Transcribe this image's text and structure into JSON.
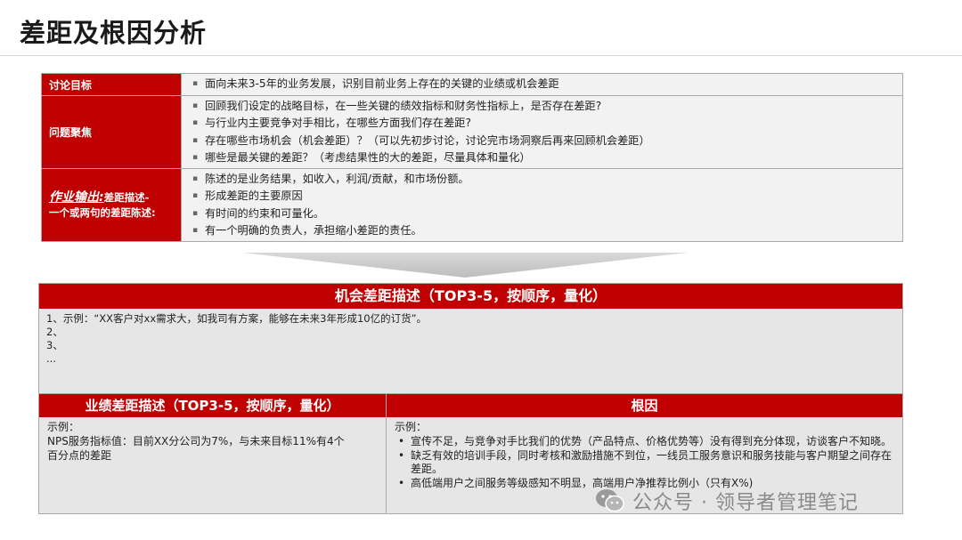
{
  "page": {
    "title": "差距及根因分析"
  },
  "top": {
    "rows": [
      {
        "label": "讨论目标",
        "items": [
          "面向未来3-5年的业务发展，识别目前业务上存在的关键的业绩或机会差距"
        ]
      },
      {
        "label": "问题聚焦",
        "items": [
          "回顾我们设定的战略目标，在一些关键的绩效指标和财务性指标上，是否存在差距?",
          "与行业内主要竞争对手相比，在哪些方面我们存在差距?",
          "存在哪些市场机会（机会差距）？（可以先初步讨论，讨论完市场洞察后再来回顾机会差距）",
          "哪些是最关键的差距？（考虑结果性的大的差距，尽量具体和量化）"
        ]
      },
      {
        "label_italic": "作业输出:",
        "label_rest": "差距描述-",
        "label_line2": "一个或两句的差距陈述:",
        "items": [
          "陈述的是业务结果，如收入，利润/贡献，和市场份额。",
          "形成差距的主要原因",
          "有时间的约束和可量化。",
          "有一个明确的负责人，承担缩小差距的责任。"
        ]
      }
    ]
  },
  "opportunity": {
    "header": "机会差距描述（TOP3-5，按顺序，量化）",
    "lines": [
      "1、示例：“XX客户对xx需求大，如我司有方案，能够在未来3年形成10亿的订货”。",
      "2、",
      "3、",
      "..."
    ]
  },
  "performance": {
    "header": "业绩差距描述（TOP3-5，按顺序，量化）",
    "lines": [
      "示例：",
      "NPS服务指标值：目前XX分公司为7%，与未来目标11%有4个",
      "百分点的差距"
    ]
  },
  "root_cause": {
    "header": "根因",
    "intro": "示例：",
    "items": [
      "宣传不足，与竞争对手比我们的优势（产品特点、价格优势等）没有得到充分体现，访谈客户不知晓。",
      "缺乏有效的培训手段，同时考核和激励措施不到位，一线员工服务意识和服务技能与客户期望之间存在差距。",
      "高低端用户之间服务等级感知不明显，高端用户净推荐比例小（只有X%)"
    ]
  },
  "watermark": {
    "text": "公众号 · 领导者管理笔记"
  },
  "colors": {
    "accent": "#c00000",
    "panel": "#f2f2f2",
    "body": "#e7e6e6"
  }
}
